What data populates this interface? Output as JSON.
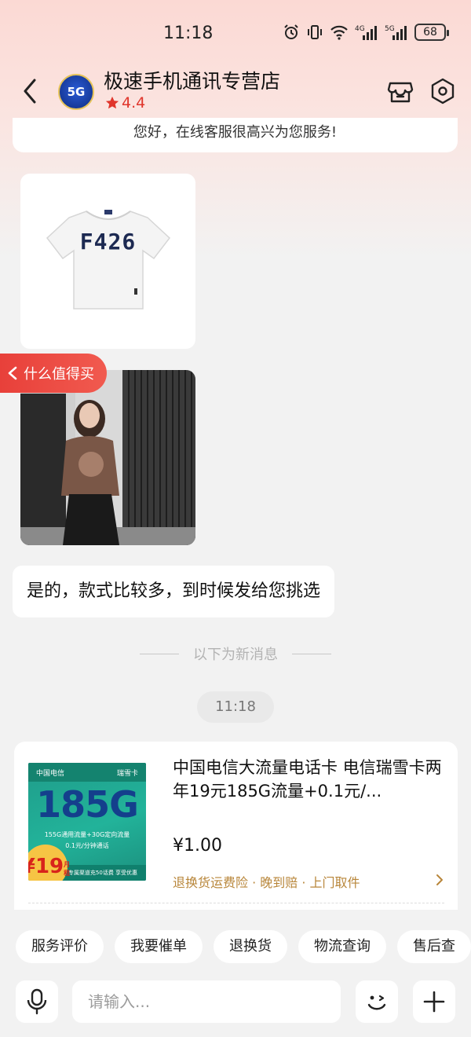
{
  "status_bar": {
    "time": "11:18",
    "battery": "68",
    "network_labels": [
      "4G",
      "5G"
    ]
  },
  "header": {
    "shop_name": "极速手机通讯专营店",
    "rating": "4.4",
    "avatar_text": "5G"
  },
  "messages": {
    "welcome": "您好，在线客服很高兴为您服务!",
    "tshirt_print": "F426",
    "side_tag": "什么值得买",
    "reply": "是的，款式比较多，到时候发给您挑选",
    "new_divider": "以下为新消息",
    "time_chip": "11:18"
  },
  "product": {
    "title": "中国电信大流量电话卡 电信瑞雪卡两年19元185G流量+0.1元/...",
    "price": "¥1.00",
    "service": "退换货运费险 · 晚到赔 · 上门取件",
    "image": {
      "brand": "中国电信",
      "card_name": "瑞雪卡",
      "big": "185G",
      "line1": "155G通用流量+30G定向流量",
      "line2": "0.1元/分钟通话",
      "badge": "¥19",
      "badge_unit": "月租",
      "footer": "专属渠道充50话费 享受优惠"
    }
  },
  "quick_actions": [
    "服务评价",
    "我要催单",
    "退换货",
    "物流查询",
    "售后查"
  ],
  "input": {
    "placeholder": "请输入..."
  },
  "colors": {
    "accent_red": "#e0352b",
    "service_gold": "#b8863a",
    "tag_red": "#e8403a"
  }
}
